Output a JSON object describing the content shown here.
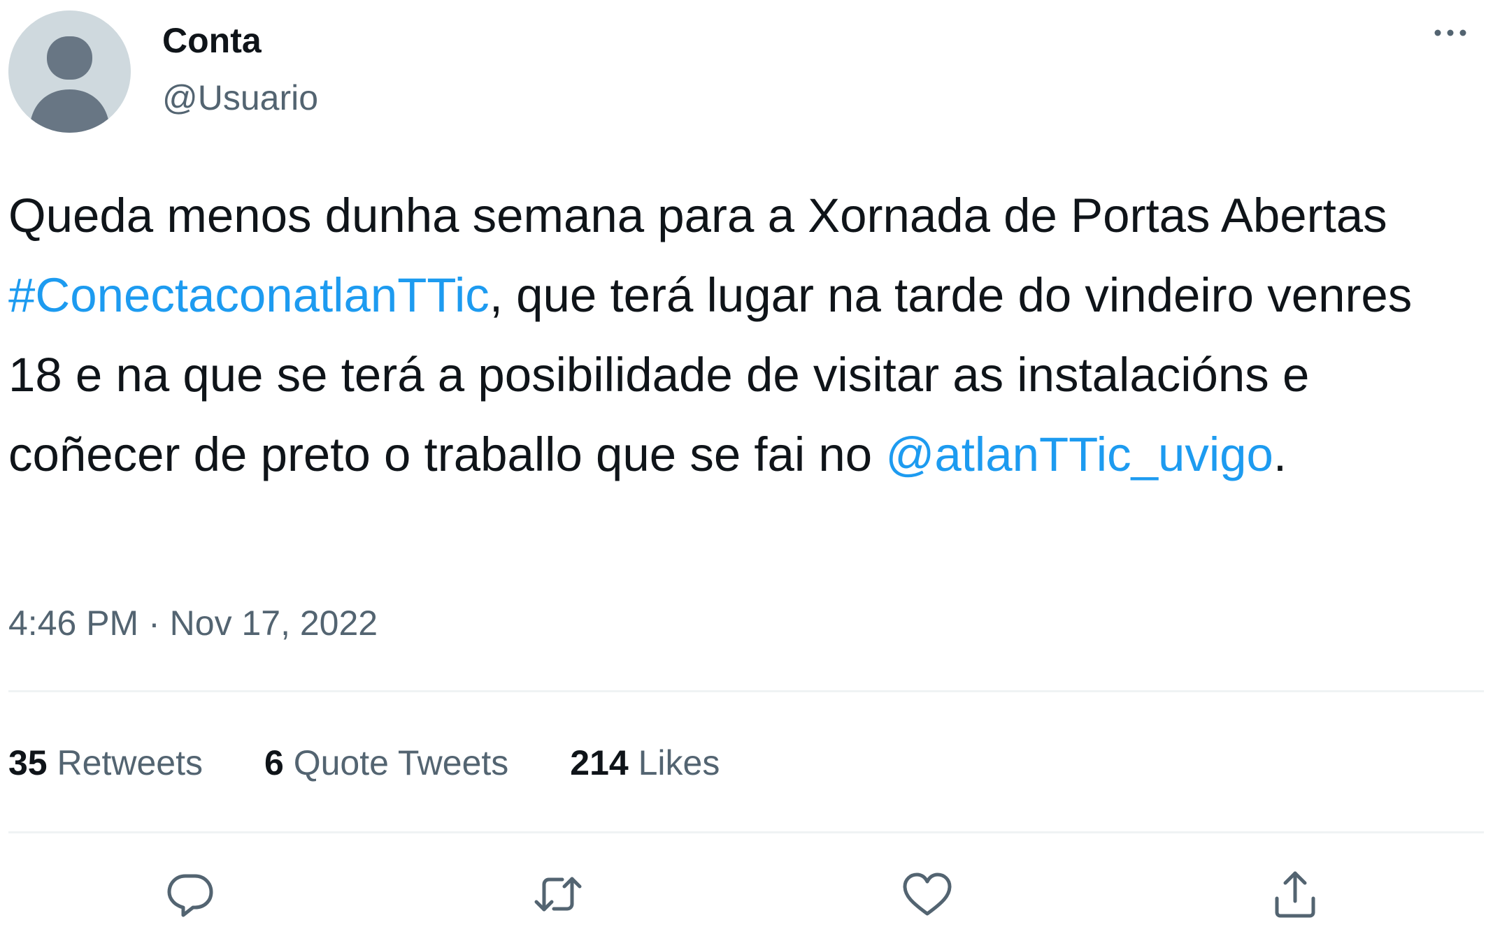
{
  "user": {
    "display_name": "Conta",
    "handle": "@Usuario",
    "avatar_icon": "default-profile-icon"
  },
  "tweet": {
    "text_segments": [
      {
        "text": "Queda menos dunha semana para a Xornada de Portas Abertas ",
        "link": false
      },
      {
        "text": "#ConectaconatlanTTic",
        "link": true
      },
      {
        "text": ", que terá lugar na tarde do vindeiro venres 18 e na que se terá a posibilidade de visitar as instalacións e coñecer de preto o traballo que se fai no ",
        "link": false
      },
      {
        "text": "@atlanTTic_uvigo",
        "link": true
      },
      {
        "text": ".",
        "link": false
      }
    ],
    "time": "4:46 PM",
    "separator": " · ",
    "date": "Nov 17, 2022"
  },
  "stats": {
    "retweets_count": "35",
    "retweets_label": "Retweets",
    "quotes_count": "6",
    "quotes_label": "Quote Tweets",
    "likes_count": "214",
    "likes_label": "Likes"
  },
  "actions": [
    "reply-icon",
    "retweet-icon",
    "like-icon",
    "share-icon"
  ],
  "colors": {
    "link": "#1d9bf0",
    "text": "#0f1419",
    "secondary": "#536471",
    "divider": "#eff3f4",
    "avatar_bg": "#cfd9de"
  }
}
